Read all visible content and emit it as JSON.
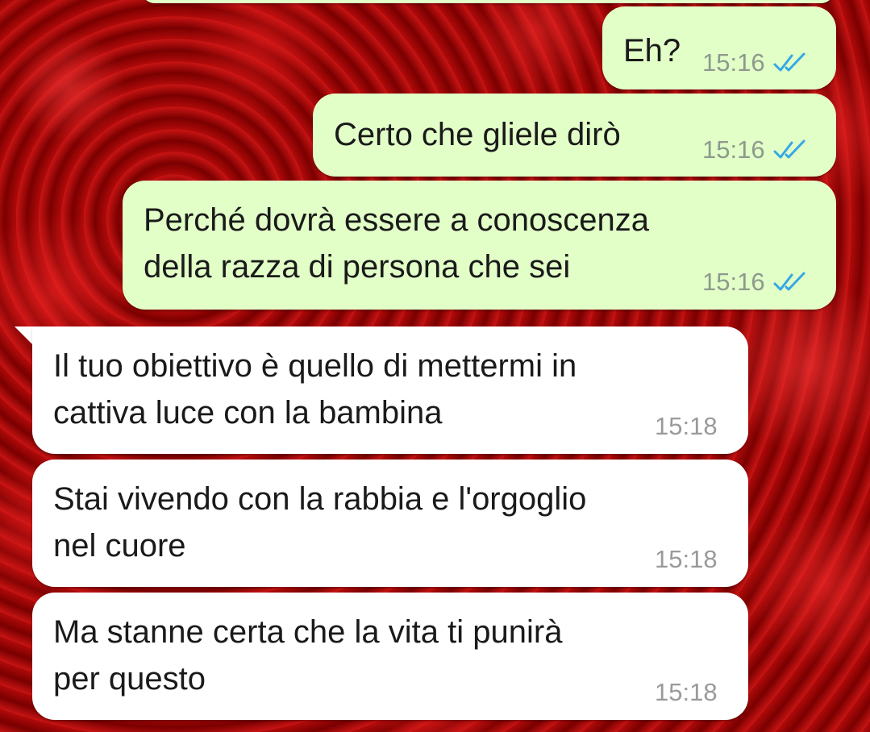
{
  "messages": [
    {
      "direction": "outgoing",
      "text": "Eh?",
      "time": "15:16",
      "status_icon": "double-check-read-icon"
    },
    {
      "direction": "outgoing",
      "text": "Certo che gliele dirò",
      "time": "15:16",
      "status_icon": "double-check-read-icon"
    },
    {
      "direction": "outgoing",
      "text": "Perché dovrà essere a conoscenza\ndella razza di persona che sei",
      "time": "15:16",
      "status_icon": "double-check-read-icon"
    },
    {
      "direction": "incoming",
      "text": "Il tuo obiettivo è quello di mettermi in\ncattiva luce con la bambina",
      "time": "15:18"
    },
    {
      "direction": "incoming",
      "text": "Stai vivendo con la rabbia e l'orgoglio\nnel cuore",
      "time": "15:18"
    },
    {
      "direction": "incoming",
      "text": "Ma stanne certa che la vita ti punirà\nper questo",
      "time": "15:18"
    }
  ],
  "colors": {
    "outgoing_bubble": "#e2ffc8",
    "incoming_bubble": "#ffffff",
    "read_ticks": "#34a8e6",
    "background": "red-roses-wallpaper"
  }
}
